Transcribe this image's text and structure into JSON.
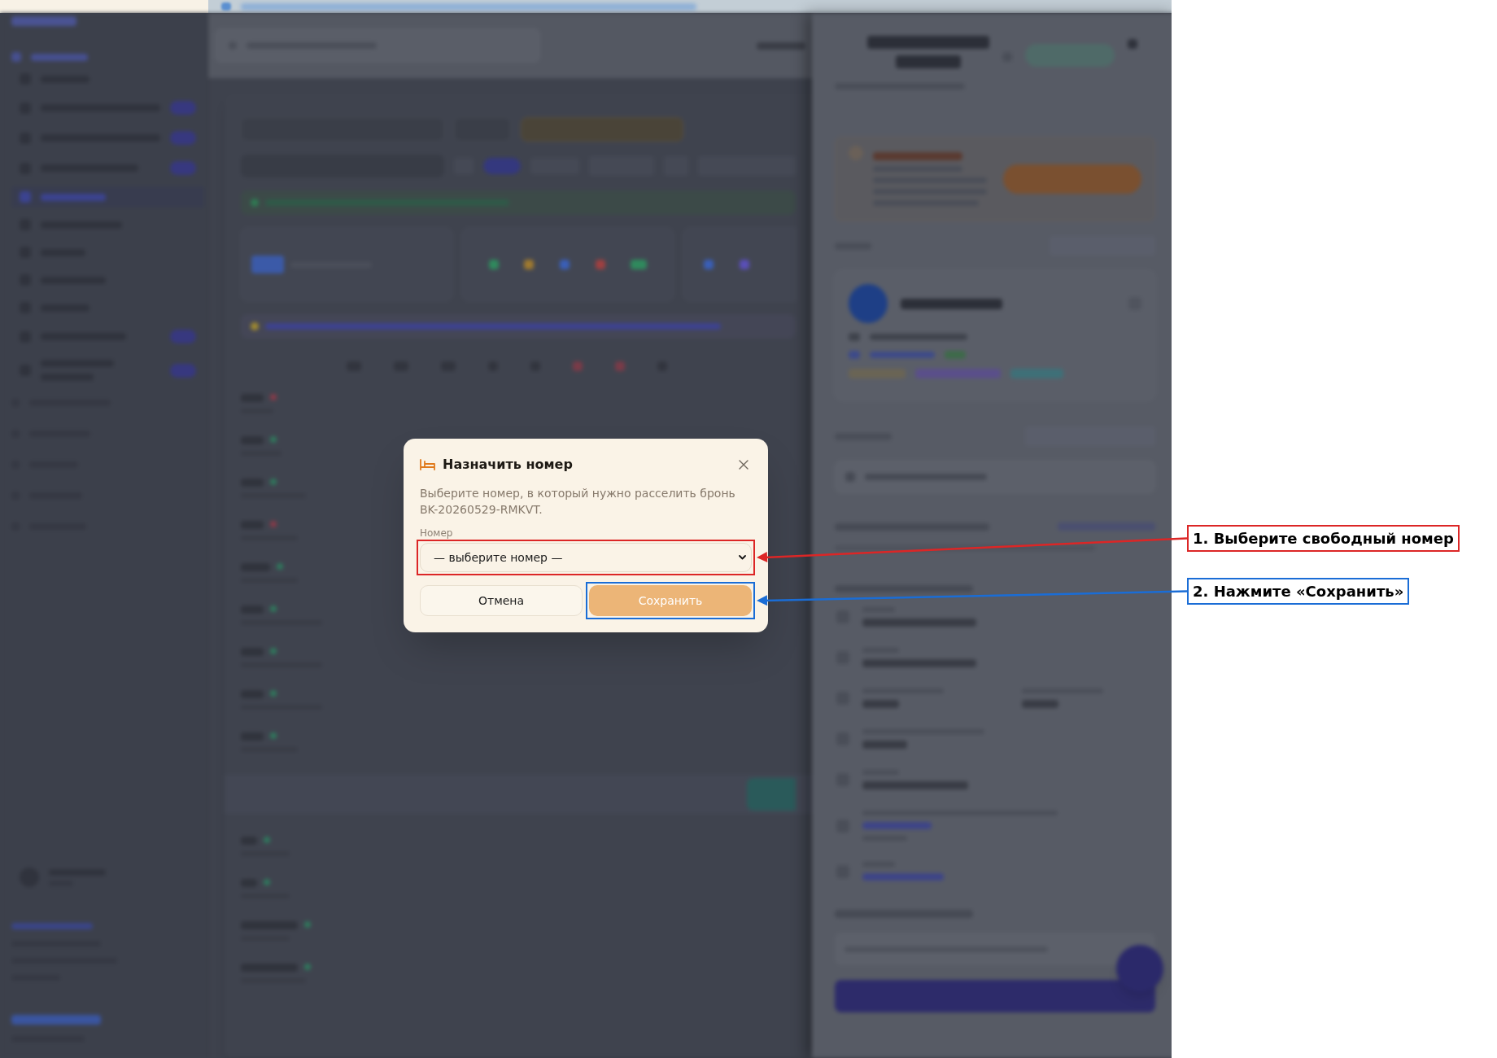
{
  "dialog": {
    "title": "Назначить номер",
    "description": "Выберите номер, в который нужно расселить бронь BK-20260529-RMKVT.",
    "field": {
      "label": "Номер",
      "value": "— выберите номер —"
    },
    "buttons": [
      {
        "label": "Отмена",
        "kind": "secondary"
      },
      {
        "label": "Сохранить",
        "kind": "primary"
      }
    ]
  },
  "annotations": [
    {
      "text": "1. Выберите свободный номер",
      "color": "#dc2626"
    },
    {
      "text": "2. Нажмите «Сохранить»",
      "color": "#1a6dd6"
    }
  ]
}
